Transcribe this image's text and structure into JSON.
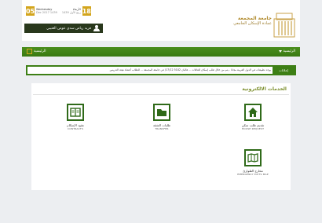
{
  "header": {
    "day_number_left": "05",
    "gregorian_line1": "Wednesday",
    "gregorian_line2": "Dec 2017",
    "gregorian_extra": "1439",
    "hijri_line1": "الأربعاء",
    "hijri_line2": "ربيع الأول 1439",
    "day_number_right": "18",
    "user_name": "فريد رياض سدي عوض العتيبي",
    "logo_line1": "جامعة المجمعة",
    "logo_line2": "عمادة الإسكان الجامعي"
  },
  "nav": {
    "home_label": "الرئيسية",
    "menu_label": "الرئيسية"
  },
  "ticker": {
    "label": "إعلانات",
    "text": "يوجد تطبيقات في الدول العربية مجانا - يتم من خلال طلب إسكان للعائلات ... قالبان 5102 17/12/ في جامعة المجمعة ... للطلاب أعضاء هيئة التدريس"
  },
  "services": {
    "title": "الخدمات الالكترونية",
    "items": [
      {
        "title": "عقود الإسكان",
        "subtitle": "CONTRACTS",
        "icon": "book-icon"
      },
      {
        "title": "طلبات الشقة",
        "subtitle": "TRANSFER",
        "icon": "folder-icon"
      },
      {
        "title": "تقديم طلب سكن",
        "subtitle": "HOUSE REQUEST",
        "icon": "home-icon"
      },
      {
        "title": "مخارج الطوارئ",
        "subtitle": "EMERGENCY EXITS MAP",
        "icon": "map-icon"
      }
    ]
  },
  "colors": {
    "nav_green": "#3d7f15",
    "gold": "#d3a51d",
    "icon_green": "#2f6a19"
  }
}
